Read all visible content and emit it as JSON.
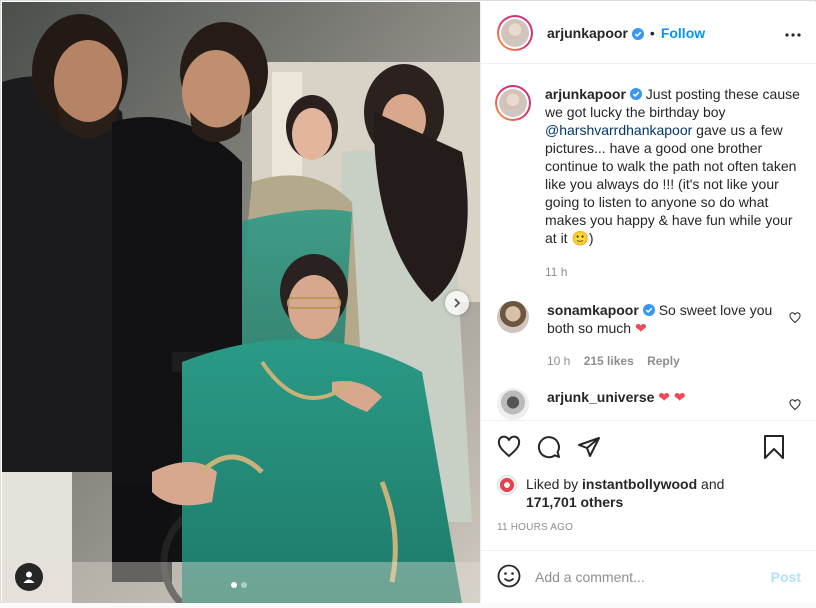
{
  "post": {
    "photo_alt": "",
    "carousel_dots": 2,
    "carousel_active": 0
  },
  "header": {
    "username": "arjunkapoor",
    "separator": "•",
    "follow_label": "Follow",
    "more_icon": "more-horizontal-icon"
  },
  "caption": {
    "username": "arjunkapoor",
    "text_before": " Just posting these cause we got lucky the birthday boy ",
    "mention": "@harshvarrdhankapoor",
    "text_after": " gave us a few pictures... have a good one brother continue to walk the path not often taken like you always do !!! (it's not like your going to listen to anyone so do what makes you happy & have fun while your at it 🙂)",
    "time": "11 h"
  },
  "comments": [
    {
      "username": "sonamkapoor",
      "verified": true,
      "text": " So sweet love you both so much ",
      "emoji": "❤",
      "time": "10 h",
      "likes": "215 likes",
      "reply": "Reply"
    },
    {
      "username": "arjunk_universe",
      "verified": false,
      "text": " ",
      "emoji": "❤ ❤"
    }
  ],
  "actions": {
    "like_icon": "heart-icon",
    "comment_icon": "comment-icon",
    "share_icon": "share-icon",
    "save_icon": "bookmark-icon"
  },
  "likes": {
    "prefix": "Liked by ",
    "user": "instantbollywood",
    "middle": " and ",
    "count": "171,701 others"
  },
  "timestamp": "11 HOURS AGO",
  "add_comment": {
    "placeholder": "Add a comment...",
    "post_label": "Post"
  },
  "colors": {
    "accent": "#0095f6",
    "heart": "#ed4956",
    "muted": "#8e8e8e",
    "post_disabled": "#b2dffc"
  }
}
